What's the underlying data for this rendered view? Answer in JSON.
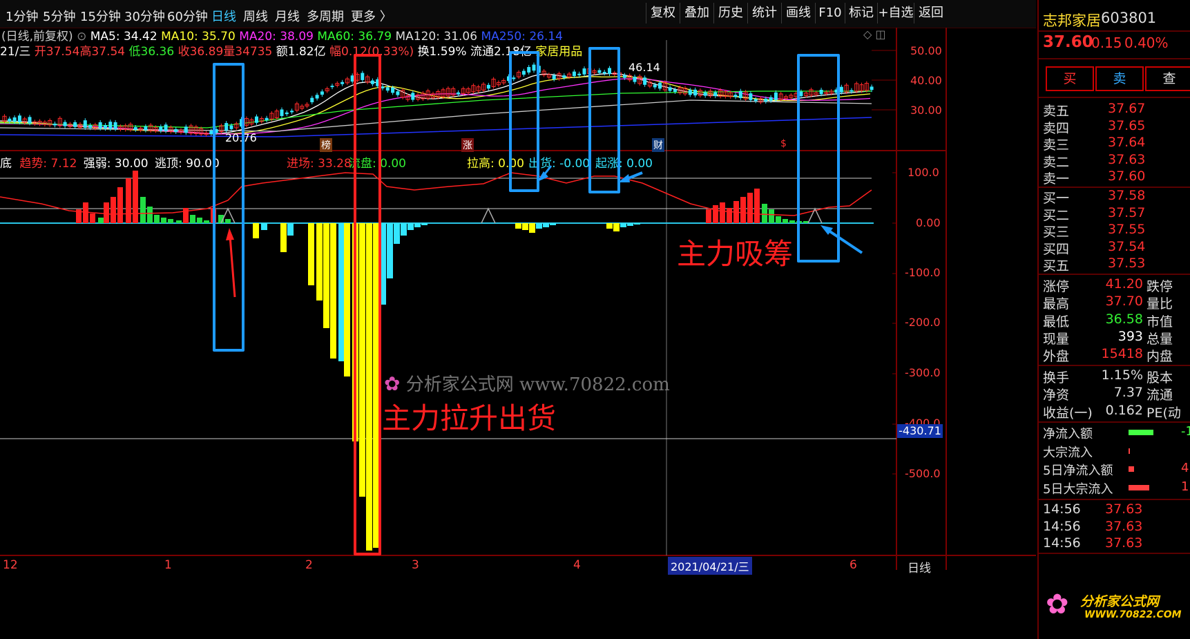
{
  "toolbar": {
    "periods": [
      "1分钟",
      "5分钟",
      "15分钟",
      "30分钟",
      "60分钟",
      "日线",
      "周线",
      "月线",
      "多周期",
      "更多 〉"
    ],
    "buttons": [
      "复权",
      "叠加",
      "历史",
      "统计",
      "画线",
      "F10",
      "标记",
      "+自选",
      "返回"
    ]
  },
  "stock": {
    "name": "志邦家居",
    "code": "603801",
    "price": "37.60",
    "change": "0.15",
    "pct": "0.40%"
  },
  "main_info": {
    "mode": "日线,前复权",
    "ma5": "MA5: 34.42",
    "ma10": "MA10: 35.70",
    "ma20": "MA20: 38.09",
    "ma60": "MA60: 36.79",
    "ma120": "MA120: 31.06",
    "ma250": "MA250: 26.14",
    "date": "21/三",
    "open": "开37.54",
    "high": "高37.54",
    "low": "低36.36",
    "close": "收36.89",
    "vol": "量34735",
    "amount": "额1.82亿",
    "amp": "幅0.12(0.33%)",
    "turnover": "换1.59%",
    "float": "流通2.18亿",
    "industry": "家居用品"
  },
  "indicator_info": {
    "prefix": "底",
    "trend": "趋势: 7.12",
    "strength": "强弱: 30.00",
    "top": "逃顶: 90.00",
    "entry": "进场: 33.28",
    "flow": "流盘: 0.00",
    "pull": "拉高: 0.00",
    "ship": "出货: -0.00",
    "start": "起涨: 0.00"
  },
  "price_axis": [
    "50.00",
    "40.00",
    "30.00"
  ],
  "ind_axis": [
    "100.0",
    "0.00",
    "-100.0",
    "-200.0",
    "-300.0",
    "-400.0",
    "-500.0"
  ],
  "cursor_value": "-430.71",
  "peak_label": "46.14",
  "low_label": "20.76",
  "event_tags": [
    "榜",
    "涨",
    "财",
    "$"
  ],
  "x_labels": [
    "12",
    "1",
    "2",
    "3",
    "4",
    "6"
  ],
  "cursor_date": "2021/04/21/三",
  "period_label": "日线",
  "annotations": {
    "pump": "主力拉升出货",
    "absorb": "主力吸筹"
  },
  "watermark": {
    "main": "分析家公式网 www.70822.com",
    "brand": "分析家公式网",
    "url": "WWW.70822.COM"
  },
  "trade_buttons": [
    "买",
    "卖",
    "查"
  ],
  "sell_orders": [
    {
      "label": "卖五",
      "price": "37.67"
    },
    {
      "label": "卖四",
      "price": "37.65"
    },
    {
      "label": "卖三",
      "price": "37.64"
    },
    {
      "label": "卖二",
      "price": "37.63"
    },
    {
      "label": "卖一",
      "price": "37.60"
    }
  ],
  "buy_orders": [
    {
      "label": "买一",
      "price": "37.58"
    },
    {
      "label": "买二",
      "price": "37.57"
    },
    {
      "label": "买三",
      "price": "37.55"
    },
    {
      "label": "买四",
      "price": "37.54"
    },
    {
      "label": "买五",
      "price": "37.53"
    }
  ],
  "stats1": [
    {
      "label": "涨停",
      "value": "41.20",
      "label2": "跌停"
    },
    {
      "label": "最高",
      "value": "37.70",
      "label2": "量比"
    },
    {
      "label": "最低",
      "value": "36.58",
      "label2": "市值"
    },
    {
      "label": "现量",
      "value": "393",
      "label2": "总量"
    },
    {
      "label": "外盘",
      "value": "15418",
      "label2": "内盘"
    }
  ],
  "stats2": [
    {
      "label": "换手",
      "value": "1.15%",
      "label2": "股本"
    },
    {
      "label": "净资",
      "value": "7.37",
      "label2": "流通"
    },
    {
      "label": "收益(一)",
      "value": "0.162",
      "label2": "PE(动"
    }
  ],
  "flows": [
    {
      "label": "净流入额",
      "value": "-1"
    },
    {
      "label": "大宗流入",
      "value": ""
    },
    {
      "label": "5日净流入额",
      "value": "4"
    },
    {
      "label": "5日大宗流入",
      "value": "1"
    }
  ],
  "ticks": [
    {
      "time": "14:56",
      "price": "37.63"
    },
    {
      "time": "14:56",
      "price": "37.63"
    },
    {
      "time": "14:56",
      "price": "37.63"
    }
  ],
  "colors": {
    "up": "#ff2a2a",
    "down": "#22dd44",
    "yellow": "#ffff00",
    "cyan": "#33e5ff",
    "box_blue": "#1e9bff",
    "box_red": "#ff2020"
  }
}
